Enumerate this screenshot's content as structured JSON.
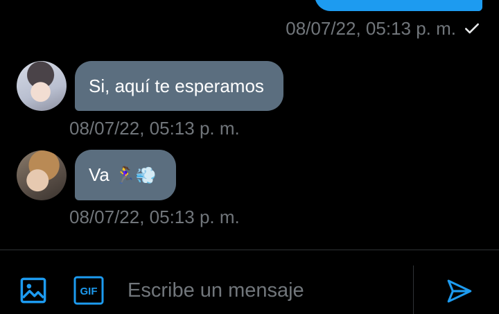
{
  "conversation": {
    "sent": {
      "timestamp": "08/07/22, 05:13 p. m.",
      "status_icon": "check-icon"
    },
    "received": [
      {
        "text": "Si, aquí te esperamos",
        "timestamp": "08/07/22, 05:13 p. m.",
        "avatar": "avatar-photo"
      },
      {
        "text": "Va",
        "emoji": "🏃‍♀️💨",
        "timestamp": "08/07/22, 05:13 p. m.",
        "avatar": "avatar-photo"
      }
    ]
  },
  "composer": {
    "placeholder": "Escribe un mensaje",
    "image_icon": "image-icon",
    "gif_icon": "gif-icon",
    "gif_label": "GIF",
    "send_icon": "send-icon"
  },
  "colors": {
    "background": "#000000",
    "accent": "#1d9bf0",
    "received_bubble": "#5b6e7f",
    "timestamp": "#71767b",
    "divider": "#2f3336"
  }
}
